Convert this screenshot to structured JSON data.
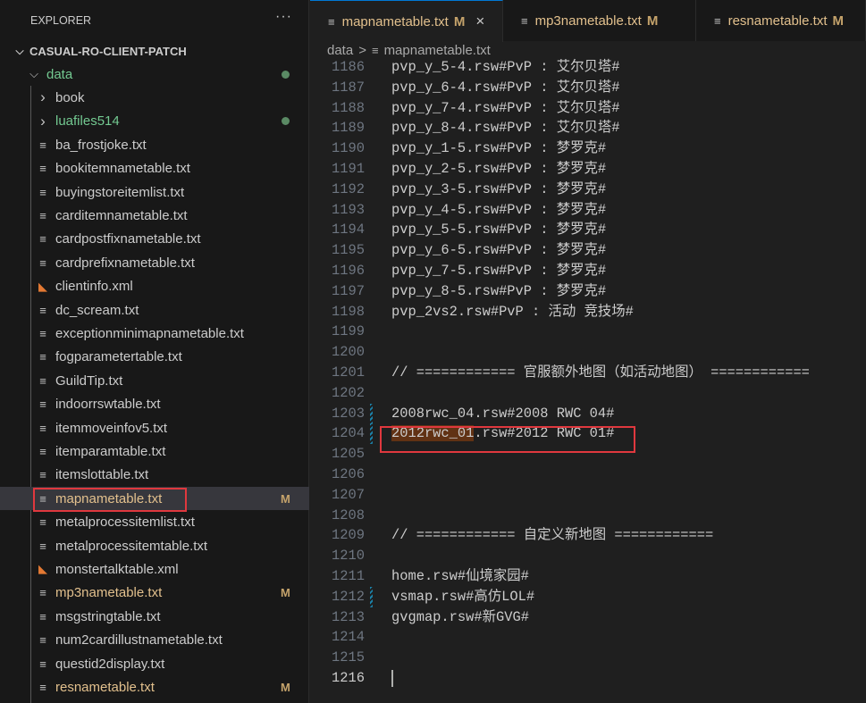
{
  "explorer": {
    "title": "EXPLORER",
    "more_icon": "ellipsis-icon",
    "root": "CASUAL-RO-CLIENT-PATCH",
    "items": [
      {
        "label": "data",
        "type": "folder-open",
        "color": "green",
        "dot": true
      },
      {
        "label": "book",
        "type": "folder"
      },
      {
        "label": "luafiles514",
        "type": "folder",
        "color": "green",
        "dot": true
      },
      {
        "label": "ba_frostjoke.txt",
        "type": "txt"
      },
      {
        "label": "bookitemnametable.txt",
        "type": "txt"
      },
      {
        "label": "buyingstoreitemlist.txt",
        "type": "txt"
      },
      {
        "label": "carditemnametable.txt",
        "type": "txt"
      },
      {
        "label": "cardpostfixnametable.txt",
        "type": "txt"
      },
      {
        "label": "cardprefixnametable.txt",
        "type": "txt"
      },
      {
        "label": "clientinfo.xml",
        "type": "xml"
      },
      {
        "label": "dc_scream.txt",
        "type": "txt"
      },
      {
        "label": "exceptionminimapnametable.txt",
        "type": "txt"
      },
      {
        "label": "fogparametertable.txt",
        "type": "txt"
      },
      {
        "label": "GuildTip.txt",
        "type": "txt"
      },
      {
        "label": "indoorrswtable.txt",
        "type": "txt"
      },
      {
        "label": "itemmoveinfov5.txt",
        "type": "txt"
      },
      {
        "label": "itemparamtable.txt",
        "type": "txt"
      },
      {
        "label": "itemslottable.txt",
        "type": "txt"
      },
      {
        "label": "mapnametable.txt",
        "type": "txt",
        "color": "yellow",
        "badge": "M",
        "selected": true
      },
      {
        "label": "metalprocessitemlist.txt",
        "type": "txt"
      },
      {
        "label": "metalprocessitemtable.txt",
        "type": "txt"
      },
      {
        "label": "monstertalktable.xml",
        "type": "xml"
      },
      {
        "label": "mp3nametable.txt",
        "type": "txt",
        "color": "yellow",
        "badge": "M"
      },
      {
        "label": "msgstringtable.txt",
        "type": "txt"
      },
      {
        "label": "num2cardillustnametable.txt",
        "type": "txt"
      },
      {
        "label": "questid2display.txt",
        "type": "txt"
      },
      {
        "label": "resnametable.txt",
        "type": "txt",
        "color": "yellow",
        "badge": "M"
      }
    ]
  },
  "tabs": [
    {
      "label": "mapnametable.txt",
      "badge": "M",
      "active": true,
      "close": "×"
    },
    {
      "label": "mp3nametable.txt",
      "badge": "M"
    },
    {
      "label": "resnametable.txt",
      "badge": "M"
    }
  ],
  "breadcrumb": {
    "folder": "data",
    "sep": ">",
    "file": "mapnametable.txt"
  },
  "editor": {
    "lines": [
      {
        "n": "1186",
        "t": "pvp_y_5-4.rsw#PvP : 艾尔贝塔#"
      },
      {
        "n": "1187",
        "t": "pvp_y_6-4.rsw#PvP : 艾尔贝塔#"
      },
      {
        "n": "1188",
        "t": "pvp_y_7-4.rsw#PvP : 艾尔贝塔#"
      },
      {
        "n": "1189",
        "t": "pvp_y_8-4.rsw#PvP : 艾尔贝塔#"
      },
      {
        "n": "1190",
        "t": "pvp_y_1-5.rsw#PvP : 梦罗克#"
      },
      {
        "n": "1191",
        "t": "pvp_y_2-5.rsw#PvP : 梦罗克#"
      },
      {
        "n": "1192",
        "t": "pvp_y_3-5.rsw#PvP : 梦罗克#"
      },
      {
        "n": "1193",
        "t": "pvp_y_4-5.rsw#PvP : 梦罗克#"
      },
      {
        "n": "1194",
        "t": "pvp_y_5-5.rsw#PvP : 梦罗克#"
      },
      {
        "n": "1195",
        "t": "pvp_y_6-5.rsw#PvP : 梦罗克#"
      },
      {
        "n": "1196",
        "t": "pvp_y_7-5.rsw#PvP : 梦罗克#"
      },
      {
        "n": "1197",
        "t": "pvp_y_8-5.rsw#PvP : 梦罗克#"
      },
      {
        "n": "1198",
        "t": "pvp_2vs2.rsw#PvP : 活动 竞技场#"
      },
      {
        "n": "1199",
        "t": ""
      },
      {
        "n": "1200",
        "t": ""
      },
      {
        "n": "1201",
        "t": "// ============ 官服额外地图（如活动地图） ============"
      },
      {
        "n": "1202",
        "t": ""
      },
      {
        "n": "1203",
        "t": "2008rwc_04.rsw#2008 RWC 04#",
        "mod": true
      },
      {
        "n": "1204",
        "t": ".rsw#2012 RWC 01#",
        "hl": "2012rwc_01",
        "mod": true
      },
      {
        "n": "1205",
        "t": ""
      },
      {
        "n": "1206",
        "t": ""
      },
      {
        "n": "1207",
        "t": ""
      },
      {
        "n": "1208",
        "t": ""
      },
      {
        "n": "1209",
        "t": "// ============ 自定义新地图 ============"
      },
      {
        "n": "1210",
        "t": ""
      },
      {
        "n": "1211",
        "t": "home.rsw#仙境家园#"
      },
      {
        "n": "1212",
        "t": "vsmap.rsw#高仿LOL#",
        "mod": true
      },
      {
        "n": "1213",
        "t": "gvgmap.rsw#新GVG#"
      },
      {
        "n": "1214",
        "t": ""
      },
      {
        "n": "1215",
        "t": ""
      },
      {
        "n": "1216",
        "t": "",
        "current": true
      }
    ]
  }
}
